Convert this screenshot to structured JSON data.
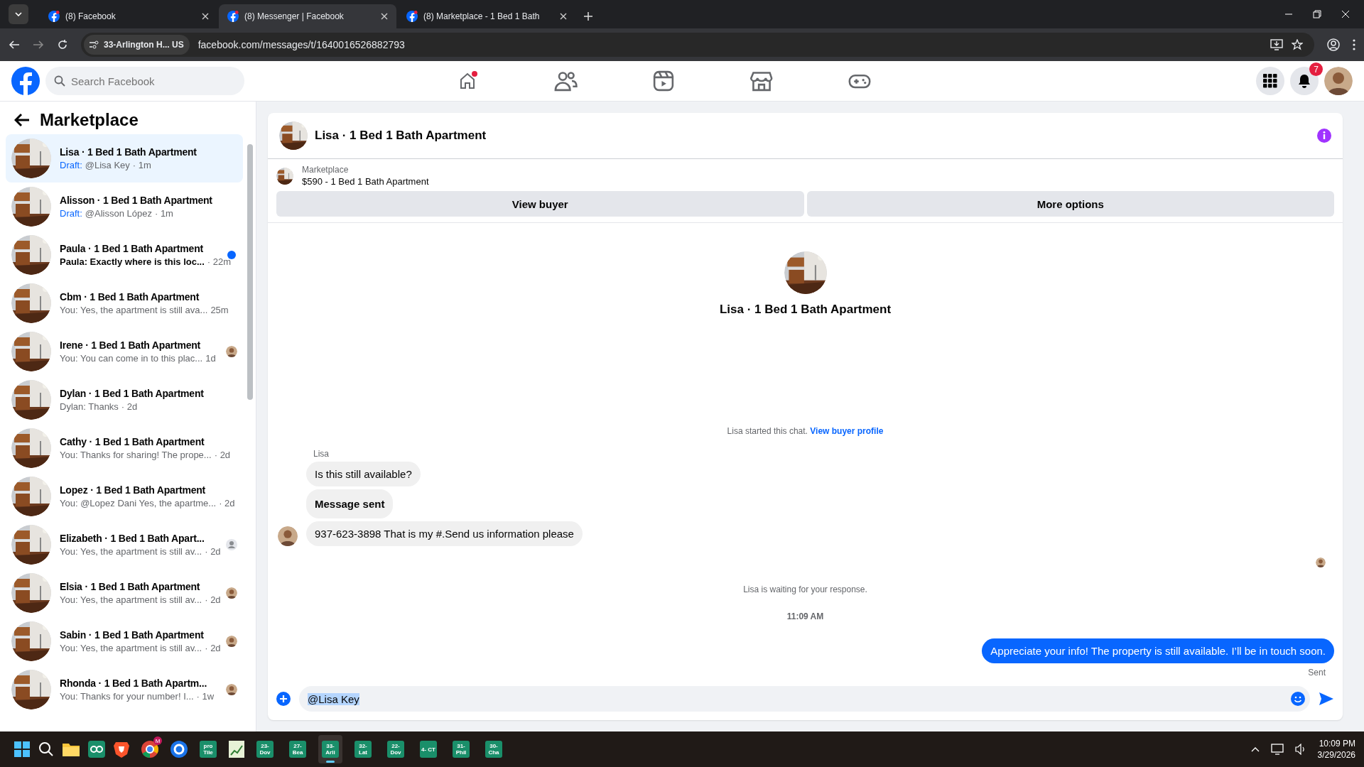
{
  "browser": {
    "tabs": [
      {
        "title": "(8) Facebook",
        "selected": false
      },
      {
        "title": "(8) Messenger | Facebook",
        "selected": true
      },
      {
        "title": "(8) Marketplace - 1 Bed 1 Bath",
        "selected": false
      }
    ],
    "site_chip": "33-Arlington H... US",
    "url": "facebook.com/messages/t/1640016526882793"
  },
  "topbar": {
    "search": {
      "placeholder": "Search Facebook"
    },
    "notifications_badge": "7"
  },
  "sidebar": {
    "title": "Marketplace",
    "conversations": [
      {
        "name": "Lisa · 1 Bed 1 Bath Apartment",
        "draft": "Draft:",
        "preview": "@Lisa Key",
        "time": "· 1m",
        "unread": false,
        "kind": "none",
        "selected": true
      },
      {
        "name": "Alisson · 1 Bed 1 Bath Apartment",
        "draft": "Draft:",
        "preview": "@Alisson López",
        "time": "· 1m",
        "unread": false,
        "kind": "none",
        "selected": false
      },
      {
        "name": "Paula · 1 Bed 1 Bath Apartment",
        "preview": "Paula: Exactly where is this loc...",
        "time": "· 22m",
        "unread": true,
        "kind": "dot",
        "selected": false
      },
      {
        "name": "Cbm · 1 Bed 1 Bath Apartment",
        "preview": "You: Yes, the apartment is still ava...",
        "time": "25m",
        "unread": false,
        "kind": "none",
        "selected": false
      },
      {
        "name": "Irene · 1 Bed 1 Bath Apartment",
        "preview": "You: You can come in to this plac...",
        "time": "1d",
        "unread": false,
        "kind": "avatar",
        "selected": false
      },
      {
        "name": "Dylan · 1 Bed 1 Bath Apartment",
        "preview": "Dylan: Thanks",
        "time": "· 2d",
        "unread": false,
        "kind": "none",
        "selected": false
      },
      {
        "name": "Cathy · 1 Bed 1 Bath Apartment",
        "preview": "You: Thanks for sharing! The prope...",
        "time": "· 2d",
        "unread": false,
        "kind": "none",
        "selected": false
      },
      {
        "name": "Lopez · 1 Bed 1 Bath Apartment",
        "preview": "You: @Lopez Dani Yes, the apartme...",
        "time": "· 2d",
        "unread": false,
        "kind": "none",
        "selected": false
      },
      {
        "name": "Elizabeth · 1 Bed 1 Bath Apart...",
        "preview": "You: Yes, the apartment is still av...",
        "time": "· 2d",
        "unread": false,
        "kind": "silhouette",
        "selected": false
      },
      {
        "name": "Elsia · 1 Bed 1 Bath Apartment",
        "preview": "You: Yes, the apartment is still av...",
        "time": "· 2d",
        "unread": false,
        "kind": "avatar",
        "selected": false
      },
      {
        "name": "Sabin · 1 Bed 1 Bath Apartment",
        "preview": "You: Yes, the apartment is still av...",
        "time": "· 2d",
        "unread": false,
        "kind": "avatar",
        "selected": false
      },
      {
        "name": "Rhonda · 1 Bed 1 Bath Apartm...",
        "preview": "You: Thanks for your number! I...",
        "time": "· 1w",
        "unread": false,
        "kind": "avatar",
        "selected": false
      }
    ]
  },
  "chat": {
    "title": "Lisa · 1 Bed 1 Bath Apartment",
    "listing": {
      "label": "Marketplace",
      "price_title": "$590 - 1 Bed 1 Bath Apartment"
    },
    "buttons": [
      "View buyer",
      "More options"
    ],
    "profile_name": "Lisa · 1 Bed 1 Bath Apartment",
    "started_text": "Lisa started this chat.",
    "started_link": "View buyer profile",
    "sender": "Lisa",
    "messages": [
      {
        "kind": "incoming",
        "text": "Is this still available?"
      },
      {
        "kind": "system",
        "text": "Message sent"
      },
      {
        "kind": "incoming",
        "text": "937-623-3898 That is my #.Send us information please"
      }
    ],
    "waiting_text": "Lisa is waiting for your response.",
    "time": "11:09 AM",
    "outgoing": "Appreciate your info! The property is still available. I’ll be in touch soon.",
    "status": "Sent",
    "composer": {
      "value": "@Lisa Key"
    }
  },
  "taskbar": {
    "apps": [
      {
        "kind": "start"
      },
      {
        "kind": "search"
      },
      {
        "kind": "folder"
      },
      {
        "kind": "glasses"
      },
      {
        "kind": "lion"
      },
      {
        "kind": "chrome",
        "badge": "M"
      },
      {
        "kind": "ring"
      },
      {
        "kind": "tile",
        "label": "pro Tile",
        "selected": false
      },
      {
        "kind": "sheet"
      },
      {
        "kind": "tile",
        "label": "23- Dov",
        "selected": false
      },
      {
        "kind": "tile",
        "label": "27- Bea",
        "selected": false
      },
      {
        "kind": "tile",
        "label": "33- Arli",
        "selected": true
      },
      {
        "kind": "tile",
        "label": "32- Lat",
        "selected": false
      },
      {
        "kind": "tile",
        "label": "22- Dov",
        "selected": false
      },
      {
        "kind": "tile",
        "label": "4- CT",
        "selected": false
      },
      {
        "kind": "tile",
        "label": "31- Phil",
        "selected": false
      },
      {
        "kind": "tile",
        "label": "30- Cha",
        "selected": false
      }
    ],
    "clock": "10:09 PM",
    "date": "3/29/2026"
  }
}
